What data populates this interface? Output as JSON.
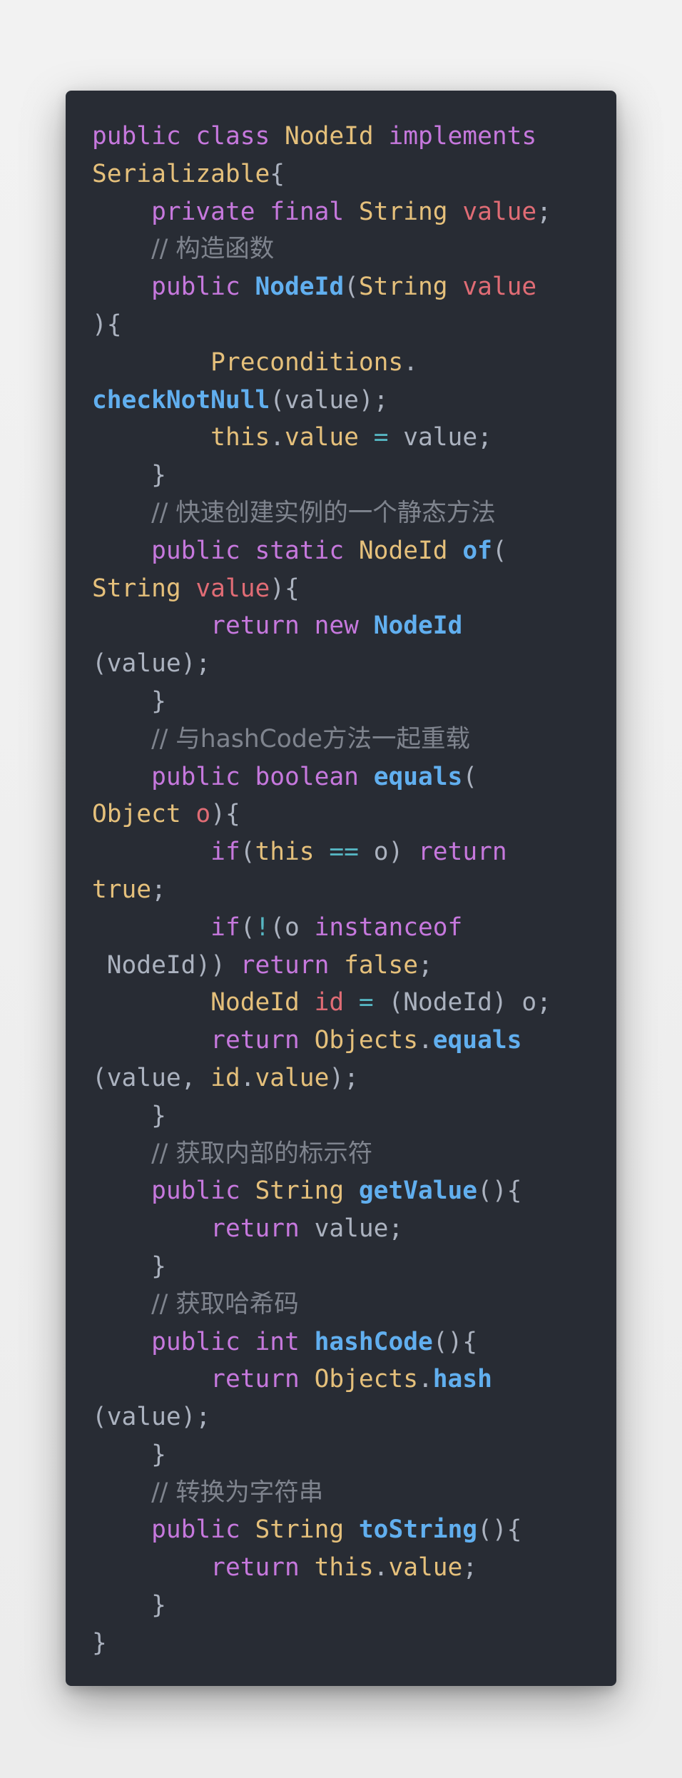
{
  "code": {
    "language": "java",
    "lines": [
      [
        {
          "t": "public",
          "c": "kw"
        },
        {
          "t": " ",
          "c": "pl"
        },
        {
          "t": "class",
          "c": "kw"
        },
        {
          "t": " ",
          "c": "pl"
        },
        {
          "t": "NodeId",
          "c": "ty"
        },
        {
          "t": " ",
          "c": "pl"
        },
        {
          "t": "implements",
          "c": "kw"
        }
      ],
      [
        {
          "t": "Serializable",
          "c": "ty"
        },
        {
          "t": "{",
          "c": "pl"
        }
      ],
      [
        {
          "t": "    ",
          "c": "pl"
        },
        {
          "t": "private",
          "c": "kw"
        },
        {
          "t": " ",
          "c": "pl"
        },
        {
          "t": "final",
          "c": "kw"
        },
        {
          "t": " ",
          "c": "pl"
        },
        {
          "t": "String",
          "c": "ty"
        },
        {
          "t": " ",
          "c": "pl"
        },
        {
          "t": "value",
          "c": "var"
        },
        {
          "t": ";",
          "c": "pl"
        }
      ],
      [
        {
          "t": "    ",
          "c": "pl"
        },
        {
          "t": "// 构造函数",
          "c": "cm"
        }
      ],
      [
        {
          "t": "    ",
          "c": "pl"
        },
        {
          "t": "public",
          "c": "kw"
        },
        {
          "t": " ",
          "c": "pl"
        },
        {
          "t": "NodeId",
          "c": "fn"
        },
        {
          "t": "(",
          "c": "pl"
        },
        {
          "t": "String",
          "c": "ty"
        },
        {
          "t": " ",
          "c": "pl"
        },
        {
          "t": "value",
          "c": "var"
        }
      ],
      [
        {
          "t": "){",
          "c": "pl"
        }
      ],
      [
        {
          "t": "        ",
          "c": "pl"
        },
        {
          "t": "Preconditions",
          "c": "ty"
        },
        {
          "t": ".",
          "c": "pl"
        }
      ],
      [
        {
          "t": "checkNotNull",
          "c": "fn"
        },
        {
          "t": "(value);",
          "c": "pl"
        }
      ],
      [
        {
          "t": "        ",
          "c": "pl"
        },
        {
          "t": "this",
          "c": "ty"
        },
        {
          "t": ".",
          "c": "pl"
        },
        {
          "t": "value",
          "c": "ty"
        },
        {
          "t": " ",
          "c": "pl"
        },
        {
          "t": "=",
          "c": "op"
        },
        {
          "t": " value;",
          "c": "pl"
        }
      ],
      [
        {
          "t": "    }",
          "c": "pl"
        }
      ],
      [
        {
          "t": "    ",
          "c": "pl"
        },
        {
          "t": "// 快速创建实例的一个静态方法",
          "c": "cm"
        }
      ],
      [
        {
          "t": "    ",
          "c": "pl"
        },
        {
          "t": "public",
          "c": "kw"
        },
        {
          "t": " ",
          "c": "pl"
        },
        {
          "t": "static",
          "c": "kw"
        },
        {
          "t": " ",
          "c": "pl"
        },
        {
          "t": "NodeId",
          "c": "ty"
        },
        {
          "t": " ",
          "c": "pl"
        },
        {
          "t": "of",
          "c": "fn"
        },
        {
          "t": "(",
          "c": "pl"
        }
      ],
      [
        {
          "t": "String",
          "c": "ty"
        },
        {
          "t": " ",
          "c": "pl"
        },
        {
          "t": "value",
          "c": "var"
        },
        {
          "t": "){",
          "c": "pl"
        }
      ],
      [
        {
          "t": "        ",
          "c": "pl"
        },
        {
          "t": "return",
          "c": "kw"
        },
        {
          "t": " ",
          "c": "pl"
        },
        {
          "t": "new",
          "c": "kw"
        },
        {
          "t": " ",
          "c": "pl"
        },
        {
          "t": "NodeId",
          "c": "fn"
        }
      ],
      [
        {
          "t": "(value);",
          "c": "pl"
        }
      ],
      [
        {
          "t": "    }",
          "c": "pl"
        }
      ],
      [
        {
          "t": "    ",
          "c": "pl"
        },
        {
          "t": "// 与hashCode方法一起重载",
          "c": "cm"
        }
      ],
      [
        {
          "t": "    ",
          "c": "pl"
        },
        {
          "t": "public",
          "c": "kw"
        },
        {
          "t": " ",
          "c": "pl"
        },
        {
          "t": "boolean",
          "c": "kw"
        },
        {
          "t": " ",
          "c": "pl"
        },
        {
          "t": "equals",
          "c": "fn"
        },
        {
          "t": "(",
          "c": "pl"
        }
      ],
      [
        {
          "t": "Object",
          "c": "ty"
        },
        {
          "t": " ",
          "c": "pl"
        },
        {
          "t": "o",
          "c": "var"
        },
        {
          "t": "){",
          "c": "pl"
        }
      ],
      [
        {
          "t": "        ",
          "c": "pl"
        },
        {
          "t": "if",
          "c": "kw"
        },
        {
          "t": "(",
          "c": "pl"
        },
        {
          "t": "this",
          "c": "ty"
        },
        {
          "t": " ",
          "c": "pl"
        },
        {
          "t": "==",
          "c": "op"
        },
        {
          "t": " o) ",
          "c": "pl"
        },
        {
          "t": "return",
          "c": "kw"
        }
      ],
      [
        {
          "t": "true",
          "c": "ty"
        },
        {
          "t": ";",
          "c": "pl"
        }
      ],
      [
        {
          "t": "        ",
          "c": "pl"
        },
        {
          "t": "if",
          "c": "kw"
        },
        {
          "t": "(",
          "c": "pl"
        },
        {
          "t": "!",
          "c": "op"
        },
        {
          "t": "(o ",
          "c": "pl"
        },
        {
          "t": "instanceof",
          "c": "kw"
        }
      ],
      [
        {
          "t": " NodeId)) ",
          "c": "pl"
        },
        {
          "t": "return",
          "c": "kw"
        },
        {
          "t": " ",
          "c": "pl"
        },
        {
          "t": "false",
          "c": "ty"
        },
        {
          "t": ";",
          "c": "pl"
        }
      ],
      [
        {
          "t": "        ",
          "c": "pl"
        },
        {
          "t": "NodeId",
          "c": "ty"
        },
        {
          "t": " ",
          "c": "pl"
        },
        {
          "t": "id",
          "c": "var"
        },
        {
          "t": " ",
          "c": "pl"
        },
        {
          "t": "=",
          "c": "op"
        },
        {
          "t": " (NodeId) o;",
          "c": "pl"
        }
      ],
      [
        {
          "t": "        ",
          "c": "pl"
        },
        {
          "t": "return",
          "c": "kw"
        },
        {
          "t": " ",
          "c": "pl"
        },
        {
          "t": "Objects",
          "c": "ty"
        },
        {
          "t": ".",
          "c": "pl"
        },
        {
          "t": "equals",
          "c": "fn"
        }
      ],
      [
        {
          "t": "(value, ",
          "c": "pl"
        },
        {
          "t": "id",
          "c": "ty"
        },
        {
          "t": ".",
          "c": "pl"
        },
        {
          "t": "value",
          "c": "ty"
        },
        {
          "t": ");",
          "c": "pl"
        }
      ],
      [
        {
          "t": "    }",
          "c": "pl"
        }
      ],
      [
        {
          "t": "    ",
          "c": "pl"
        },
        {
          "t": "// 获取内部的标示符",
          "c": "cm"
        }
      ],
      [
        {
          "t": "    ",
          "c": "pl"
        },
        {
          "t": "public",
          "c": "kw"
        },
        {
          "t": " ",
          "c": "pl"
        },
        {
          "t": "String",
          "c": "ty"
        },
        {
          "t": " ",
          "c": "pl"
        },
        {
          "t": "getValue",
          "c": "fn"
        },
        {
          "t": "(){",
          "c": "pl"
        }
      ],
      [
        {
          "t": "        ",
          "c": "pl"
        },
        {
          "t": "return",
          "c": "kw"
        },
        {
          "t": " value;",
          "c": "pl"
        }
      ],
      [
        {
          "t": "    }",
          "c": "pl"
        }
      ],
      [
        {
          "t": "    ",
          "c": "pl"
        },
        {
          "t": "// 获取哈希码",
          "c": "cm"
        }
      ],
      [
        {
          "t": "    ",
          "c": "pl"
        },
        {
          "t": "public",
          "c": "kw"
        },
        {
          "t": " ",
          "c": "pl"
        },
        {
          "t": "int",
          "c": "kw"
        },
        {
          "t": " ",
          "c": "pl"
        },
        {
          "t": "hashCode",
          "c": "fn"
        },
        {
          "t": "(){",
          "c": "pl"
        }
      ],
      [
        {
          "t": "        ",
          "c": "pl"
        },
        {
          "t": "return",
          "c": "kw"
        },
        {
          "t": " ",
          "c": "pl"
        },
        {
          "t": "Objects",
          "c": "ty"
        },
        {
          "t": ".",
          "c": "pl"
        },
        {
          "t": "hash",
          "c": "fn"
        }
      ],
      [
        {
          "t": "(value);",
          "c": "pl"
        }
      ],
      [
        {
          "t": "    }",
          "c": "pl"
        }
      ],
      [
        {
          "t": "    ",
          "c": "pl"
        },
        {
          "t": "// 转换为字符串",
          "c": "cm"
        }
      ],
      [
        {
          "t": "    ",
          "c": "pl"
        },
        {
          "t": "public",
          "c": "kw"
        },
        {
          "t": " ",
          "c": "pl"
        },
        {
          "t": "String",
          "c": "ty"
        },
        {
          "t": " ",
          "c": "pl"
        },
        {
          "t": "toString",
          "c": "fn"
        },
        {
          "t": "(){",
          "c": "pl"
        }
      ],
      [
        {
          "t": "        ",
          "c": "pl"
        },
        {
          "t": "return",
          "c": "kw"
        },
        {
          "t": " ",
          "c": "pl"
        },
        {
          "t": "this",
          "c": "ty"
        },
        {
          "t": ".",
          "c": "pl"
        },
        {
          "t": "value",
          "c": "ty"
        },
        {
          "t": ";",
          "c": "pl"
        }
      ],
      [
        {
          "t": "    }",
          "c": "pl"
        }
      ],
      [
        {
          "t": "}",
          "c": "pl"
        }
      ]
    ]
  },
  "colors": {
    "background": "#282c34",
    "keyword": "#c678dd",
    "type": "#e5c07b",
    "function": "#61afef",
    "variable": "#e06c75",
    "operator": "#56b6c2",
    "comment": "#7f848e",
    "plain": "#abb2bf"
  }
}
